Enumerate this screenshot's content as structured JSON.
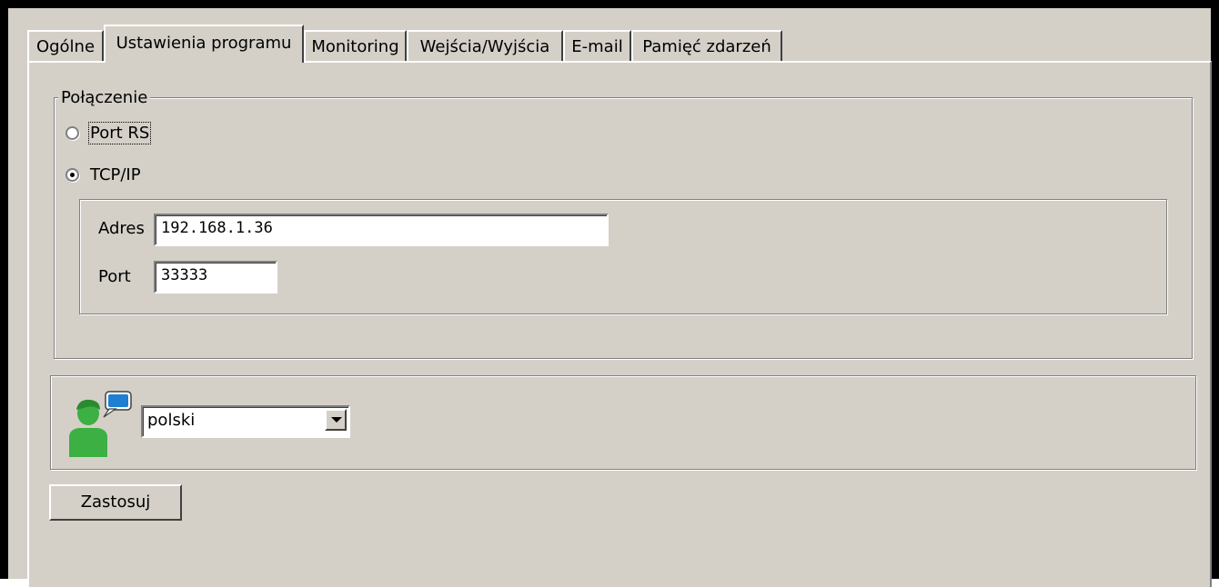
{
  "tabs": [
    {
      "label": "Ogólne",
      "active": false
    },
    {
      "label": "Ustawienia programu",
      "active": true
    },
    {
      "label": "Monitoring",
      "active": false
    },
    {
      "label": "Wejścia/Wyjścia",
      "active": false
    },
    {
      "label": "E-mail",
      "active": false
    },
    {
      "label": "Pamięć zdarzeń",
      "active": false
    }
  ],
  "connection": {
    "group_label": "Połączenie",
    "options": [
      {
        "label": "Port RS",
        "selected": false
      },
      {
        "label": "TCP/IP",
        "selected": true
      }
    ],
    "address_label": "Adres",
    "address_value": "192.168.1.36",
    "port_label": "Port",
    "port_value": "33333"
  },
  "language": {
    "icon": "user-speech-bubble-icon",
    "selected": "polski"
  },
  "apply_label": "Zastosuj",
  "colors": {
    "face": "#d4d0c8",
    "field": "#ffffff",
    "frame": "#000000",
    "icon_green": "#3cb043",
    "icon_bubble": "#1f7fd0"
  }
}
